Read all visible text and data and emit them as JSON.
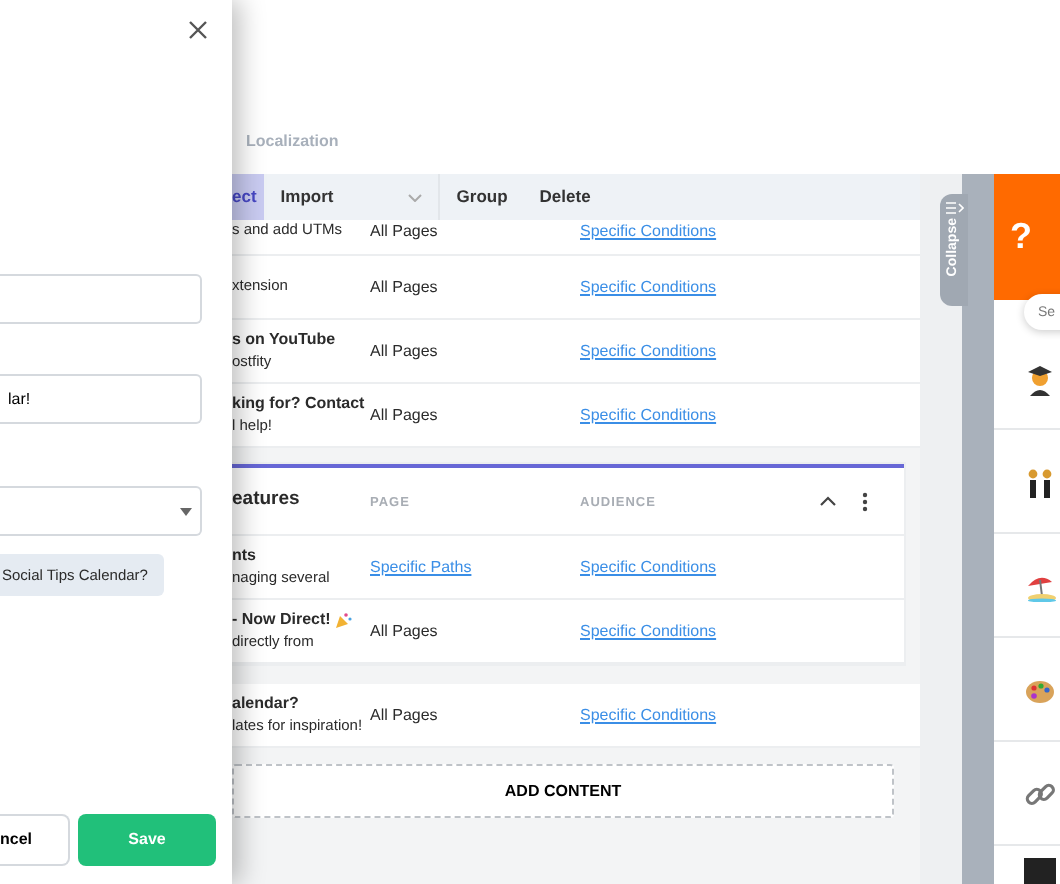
{
  "modal": {
    "fields": [
      {
        "kind": "input"
      },
      {
        "kind": "input",
        "value": "lar!"
      },
      {
        "kind": "select"
      }
    ],
    "chip": "Social Tips Calendar?",
    "buttons": [
      {
        "label": "ncel",
        "kind": "secondary"
      },
      {
        "label": "Save",
        "kind": "primary"
      }
    ]
  },
  "tabs": [
    {
      "label": "Localization",
      "selected": false
    }
  ],
  "toolbar": [
    {
      "label": "ect",
      "kind": "button",
      "selected": true
    },
    {
      "label": "Import",
      "kind": "dropdown",
      "selected": false
    },
    {
      "label": "Group",
      "kind": "button",
      "selected": false
    },
    {
      "label": "Delete",
      "kind": "button",
      "selected": false
    }
  ],
  "rows": [
    {
      "subtitle": "s and add UTMs",
      "page": "All Pages",
      "page_link": false,
      "audience": "Specific Conditions"
    },
    {
      "subtitle": "xtension",
      "page": "All Pages",
      "page_link": false,
      "audience": "Specific Conditions"
    },
    {
      "title": "s on YouTube",
      "subtitle": "ostfity",
      "page": "All Pages",
      "page_link": false,
      "audience": "Specific Conditions"
    },
    {
      "title": "king for? Contact",
      "subtitle": "l help!",
      "page": "All Pages",
      "page_link": false,
      "audience": "Specific Conditions"
    }
  ],
  "section": {
    "title": "eatures",
    "columns": [
      "PAGE",
      "AUDIENCE"
    ],
    "expanded": true,
    "rows": [
      {
        "title": "nts",
        "subtitle": "naging several",
        "kind": "plain",
        "page": "Specific Paths",
        "page_link": true,
        "audience": "Specific Conditions"
      },
      {
        "title": "- Now Direct!",
        "kind": "celebration",
        "subtitle": "directly from",
        "page": "All Pages",
        "page_link": false,
        "audience": "Specific Conditions"
      }
    ]
  },
  "loose_rows": [
    {
      "title": "alendar?",
      "subtitle": "lates for inspiration!",
      "page": "All Pages",
      "page_link": false,
      "audience": "Specific Conditions"
    }
  ],
  "add_button": "ADD CONTENT",
  "collapse_tab": "Collapse",
  "help_panel": {
    "button": "?",
    "search": {
      "placeholder": "Se"
    },
    "items": [
      {
        "kind": "student"
      },
      {
        "kind": "dancers"
      },
      {
        "kind": "beach"
      },
      {
        "kind": "palette"
      },
      {
        "kind": "link"
      },
      {
        "kind": "dark"
      }
    ]
  }
}
